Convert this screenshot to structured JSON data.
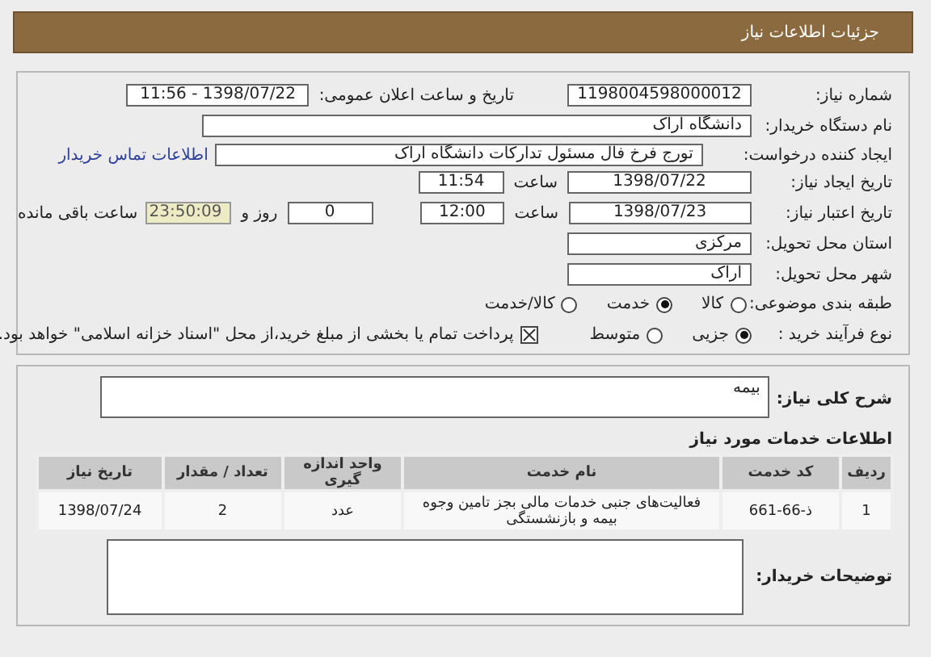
{
  "header": {
    "title": "جزئیات اطلاعات نیاز"
  },
  "need_number": {
    "label": "شماره نیاز:",
    "value": "1198004598000012"
  },
  "announcement": {
    "label": "تاریخ و ساعت اعلان عمومی:",
    "value": "1398/07/22 - 11:56"
  },
  "buyer": {
    "label": "نام دستگاه خریدار:",
    "value": "دانشگاه اراک"
  },
  "requester": {
    "label": "ایجاد کننده درخواست:",
    "value": "تورج فرخ فال مسئول تدارکات دانشگاه اراک",
    "link": "اطلاعات تماس خریدار"
  },
  "created": {
    "label": "تاریخ ایجاد نیاز:",
    "date": "1398/07/22",
    "time_label": "ساعت",
    "time": "11:54"
  },
  "validity": {
    "label": "تاریخ اعتبار نیاز:",
    "date": "1398/07/23",
    "time_label": "ساعت",
    "time": "12:00",
    "days": "0",
    "days_label": "روز و",
    "remaining": "23:50:09",
    "remaining_label": "ساعت باقی مانده"
  },
  "province": {
    "label": "استان محل تحویل:",
    "value": "مرکزی"
  },
  "city": {
    "label": "شهر محل تحویل:",
    "value": "اراک"
  },
  "category": {
    "label": "طبقه بندی موضوعی:",
    "options": [
      {
        "label": "کالا",
        "selected": false
      },
      {
        "label": "خدمت",
        "selected": true
      },
      {
        "label": "کالا/خدمت",
        "selected": false
      }
    ]
  },
  "process": {
    "label": "نوع فرآیند خرید :",
    "options": [
      {
        "label": "جزیی",
        "selected": true
      },
      {
        "label": "متوسط",
        "selected": false
      }
    ],
    "treasury": {
      "checked": true,
      "text": "پرداخت تمام یا بخشی از مبلغ خرید،از محل \"اسناد خزانه اسلامی\" خواهد بود."
    }
  },
  "description": {
    "label": "شرح کلی نیاز:",
    "value": "بیمه"
  },
  "services": {
    "title": "اطلاعات خدمات مورد نیاز",
    "columns": [
      "ردیف",
      "کد خدمت",
      "نام خدمت",
      "واحد اندازه گیری",
      "تعداد / مقدار",
      "تاریخ نیاز"
    ],
    "rows": [
      [
        "1",
        "ذ-66-661",
        "فعالیت‌های جنبی خدمات مالی بجز تامین وجوه بیمه و بازنشستگی",
        "عدد",
        "2",
        "1398/07/24"
      ]
    ]
  },
  "notes": {
    "label": "توضیحات خریدار:"
  }
}
